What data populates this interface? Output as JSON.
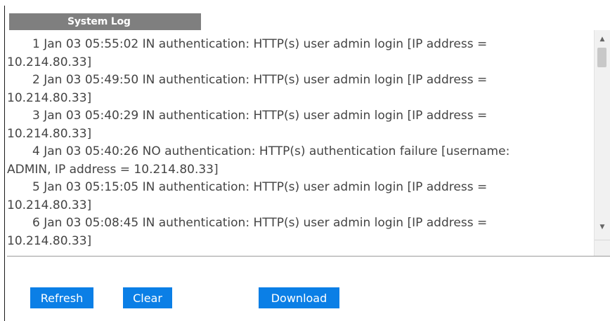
{
  "panel": {
    "title": "System Log"
  },
  "log": {
    "entries": [
      {
        "line1": "1 Jan 03 05:55:02 IN authentication: HTTP(s) user admin login [IP address =",
        "line2": "10.214.80.33]"
      },
      {
        "line1": "2 Jan 03 05:49:50 IN authentication: HTTP(s) user admin login [IP address =",
        "line2": "10.214.80.33]"
      },
      {
        "line1": "3 Jan 03 05:40:29 IN authentication: HTTP(s) user admin login [IP address =",
        "line2": "10.214.80.33]"
      },
      {
        "line1": "4 Jan 03 05:40:26 NO authentication: HTTP(s) authentication failure [username:",
        "line2": "ADMIN, IP address = 10.214.80.33]"
      },
      {
        "line1": "5 Jan 03 05:15:05 IN authentication: HTTP(s) user admin login [IP address =",
        "line2": "10.214.80.33]"
      },
      {
        "line1": "6 Jan 03 05:08:45 IN authentication: HTTP(s) user admin login [IP address =",
        "line2": "10.214.80.33]"
      }
    ]
  },
  "buttons": {
    "refresh": "Refresh",
    "clear": "Clear",
    "download": "Download"
  },
  "icons": {
    "scroll_up": "scroll-up-arrow-icon",
    "scroll_down": "scroll-down-arrow-icon"
  },
  "colors": {
    "button_bg": "#0b7fe6",
    "tab_bg": "#7f7f7f"
  }
}
